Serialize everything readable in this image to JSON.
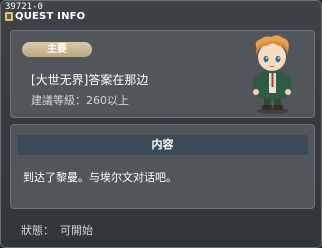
{
  "header": {
    "quest_id": "39721-0",
    "title": "QUEST INFO"
  },
  "summary": {
    "badge": "主要",
    "quest_name": "[大世无界]答案在那边",
    "recommended_level": "建議等級：260以上"
  },
  "content": {
    "header": "内容",
    "text": "到达了黎曼。与埃尔文对话吧。"
  },
  "status": {
    "label": "狀態：",
    "value": "可開始"
  },
  "colors": {
    "badge": "#c8b690",
    "content_header": "#3b4a57",
    "panel": "#505659"
  }
}
